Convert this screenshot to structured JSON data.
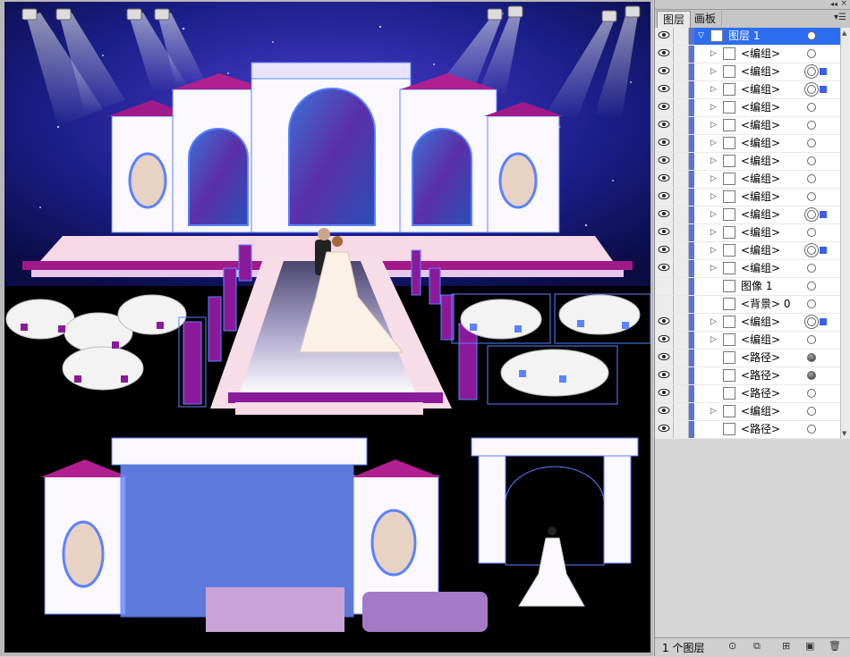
{
  "panel": {
    "tabs": [
      {
        "label": "图层"
      },
      {
        "label": "画板"
      }
    ],
    "footer_count": "1 个图层",
    "layers": [
      {
        "name": "图层 1",
        "selected": true,
        "level": 0,
        "expand": "▽",
        "target": "plain"
      },
      {
        "name": "<编组>",
        "level": 1,
        "expand": "▷",
        "target": "plain"
      },
      {
        "name": "<编组>",
        "level": 1,
        "expand": "▷",
        "target": "dbl",
        "sq": true
      },
      {
        "name": "<编组>",
        "level": 1,
        "expand": "▷",
        "target": "dbl",
        "sq": true
      },
      {
        "name": "<编组>",
        "level": 1,
        "expand": "▷",
        "target": "plain"
      },
      {
        "name": "<编组>",
        "level": 1,
        "expand": "▷",
        "target": "plain"
      },
      {
        "name": "<编组>",
        "level": 1,
        "expand": "▷",
        "target": "plain"
      },
      {
        "name": "<编组>",
        "level": 1,
        "expand": "▷",
        "target": "plain"
      },
      {
        "name": "<编组>",
        "level": 1,
        "expand": "▷",
        "target": "plain"
      },
      {
        "name": "<编组>",
        "level": 1,
        "expand": "▷",
        "target": "plain"
      },
      {
        "name": "<编组>",
        "level": 1,
        "expand": "▷",
        "target": "dbl",
        "sq": true
      },
      {
        "name": "<编组>",
        "level": 1,
        "expand": "▷",
        "target": "plain"
      },
      {
        "name": "<编组>",
        "level": 1,
        "expand": "▷",
        "target": "dbl",
        "sq": true
      },
      {
        "name": "<编组>",
        "level": 1,
        "expand": "▷",
        "target": "plain"
      },
      {
        "name": "图像 1",
        "level": 1,
        "expand": "",
        "target": "plain",
        "noeye": true
      },
      {
        "name": "<背景> 0",
        "level": 1,
        "expand": "",
        "target": "plain",
        "noeye": true
      },
      {
        "name": "<编组>",
        "level": 1,
        "expand": "▷",
        "target": "dbl",
        "sq": true
      },
      {
        "name": "<编组>",
        "level": 1,
        "expand": "▷",
        "target": "plain"
      },
      {
        "name": "<路径>",
        "level": 1,
        "expand": "",
        "target": "fill"
      },
      {
        "name": "<路径>",
        "level": 1,
        "expand": "",
        "target": "fill"
      },
      {
        "name": "<路径>",
        "level": 1,
        "expand": "",
        "target": "plain"
      },
      {
        "name": "<编组>",
        "level": 1,
        "expand": "▷",
        "target": "plain"
      },
      {
        "name": "<路径>",
        "level": 1,
        "expand": "",
        "target": "plain"
      }
    ]
  },
  "icons": {
    "eye": "eye-icon",
    "expand": "disclosure-triangle-icon",
    "target": "target-circle-icon",
    "footer": [
      "locate-object-icon",
      "make-clipping-mask-icon",
      "create-sublayer-icon",
      "new-layer-icon",
      "delete-icon"
    ]
  },
  "colors": {
    "selection": "#2c6df0",
    "layer_bar": "#5a73d8",
    "stage_blue": "#1b1f8a",
    "purple_accent": "#8a1a9a",
    "path_highlight": "#5b82ff"
  }
}
